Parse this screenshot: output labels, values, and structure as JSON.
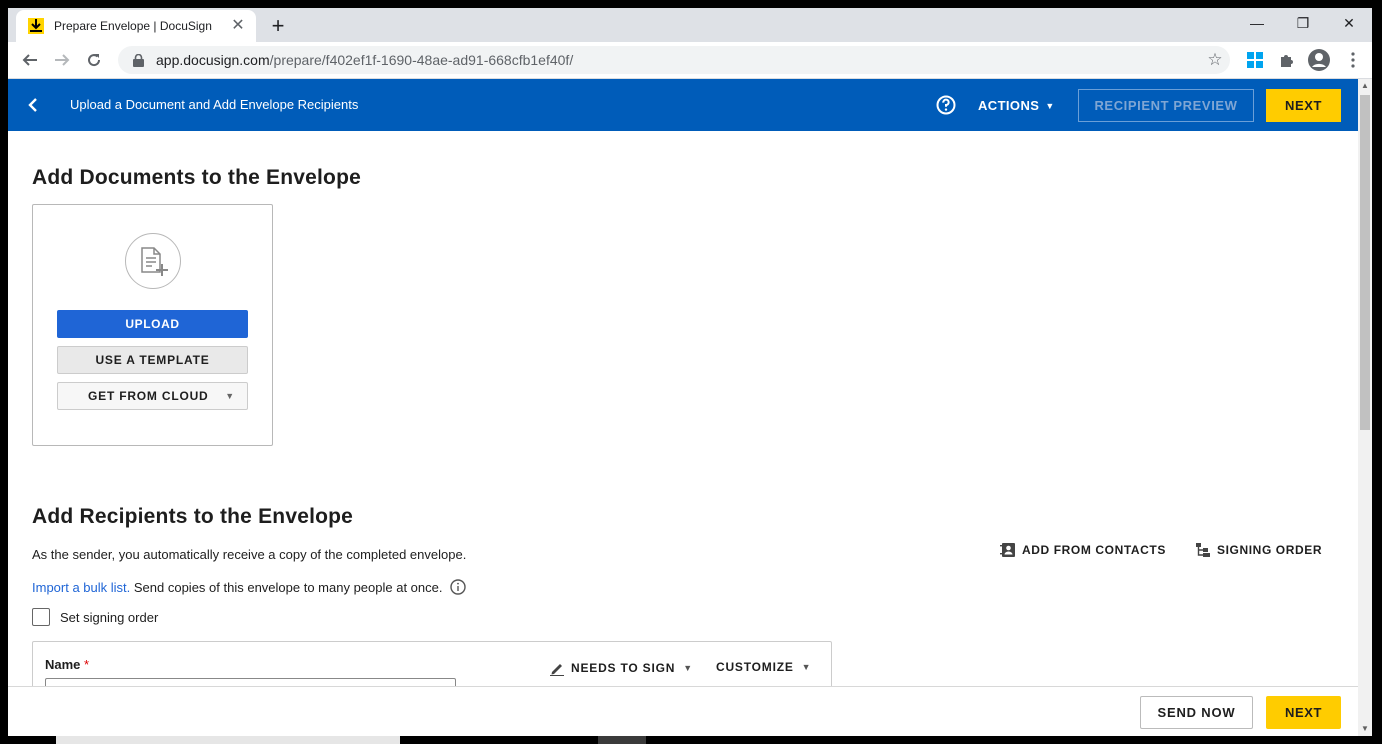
{
  "browser": {
    "tab_title": "Prepare Envelope | DocuSign",
    "tab_close": "✕",
    "new_tab": "+",
    "url_domain": "app.docusign.com",
    "url_path": "/prepare/f402ef1f-1690-48ae-ad91-668cfb1ef40f/",
    "window_controls": {
      "minimize": "—",
      "restore": "❐",
      "close": "✕"
    }
  },
  "header": {
    "title": "Upload a Document and Add Envelope Recipients",
    "actions_label": "ACTIONS",
    "recipient_preview_label": "RECIPIENT PREVIEW",
    "next_label": "NEXT"
  },
  "documents": {
    "heading": "Add Documents to the Envelope",
    "upload_label": "UPLOAD",
    "template_label": "USE A TEMPLATE",
    "cloud_label": "GET FROM CLOUD"
  },
  "recipients": {
    "heading": "Add Recipients to the Envelope",
    "sender_note": "As the sender, you automatically receive a copy of the completed envelope.",
    "bulk_link": "Import a bulk list.",
    "bulk_text": " Send copies of this envelope to many people at once.",
    "add_from_contacts": "ADD FROM CONTACTS",
    "signing_order": "SIGNING ORDER",
    "set_signing_order": "Set signing order",
    "name_label": "Name",
    "required_mark": "*",
    "needs_to_sign": "NEEDS TO SIGN",
    "customize": "CUSTOMIZE"
  },
  "footer": {
    "send_now_label": "SEND NOW",
    "next_label": "NEXT"
  },
  "colors": {
    "header_blue": "#005cb9",
    "accent_yellow": "#ffcc00",
    "upload_blue": "#1f65d6"
  }
}
